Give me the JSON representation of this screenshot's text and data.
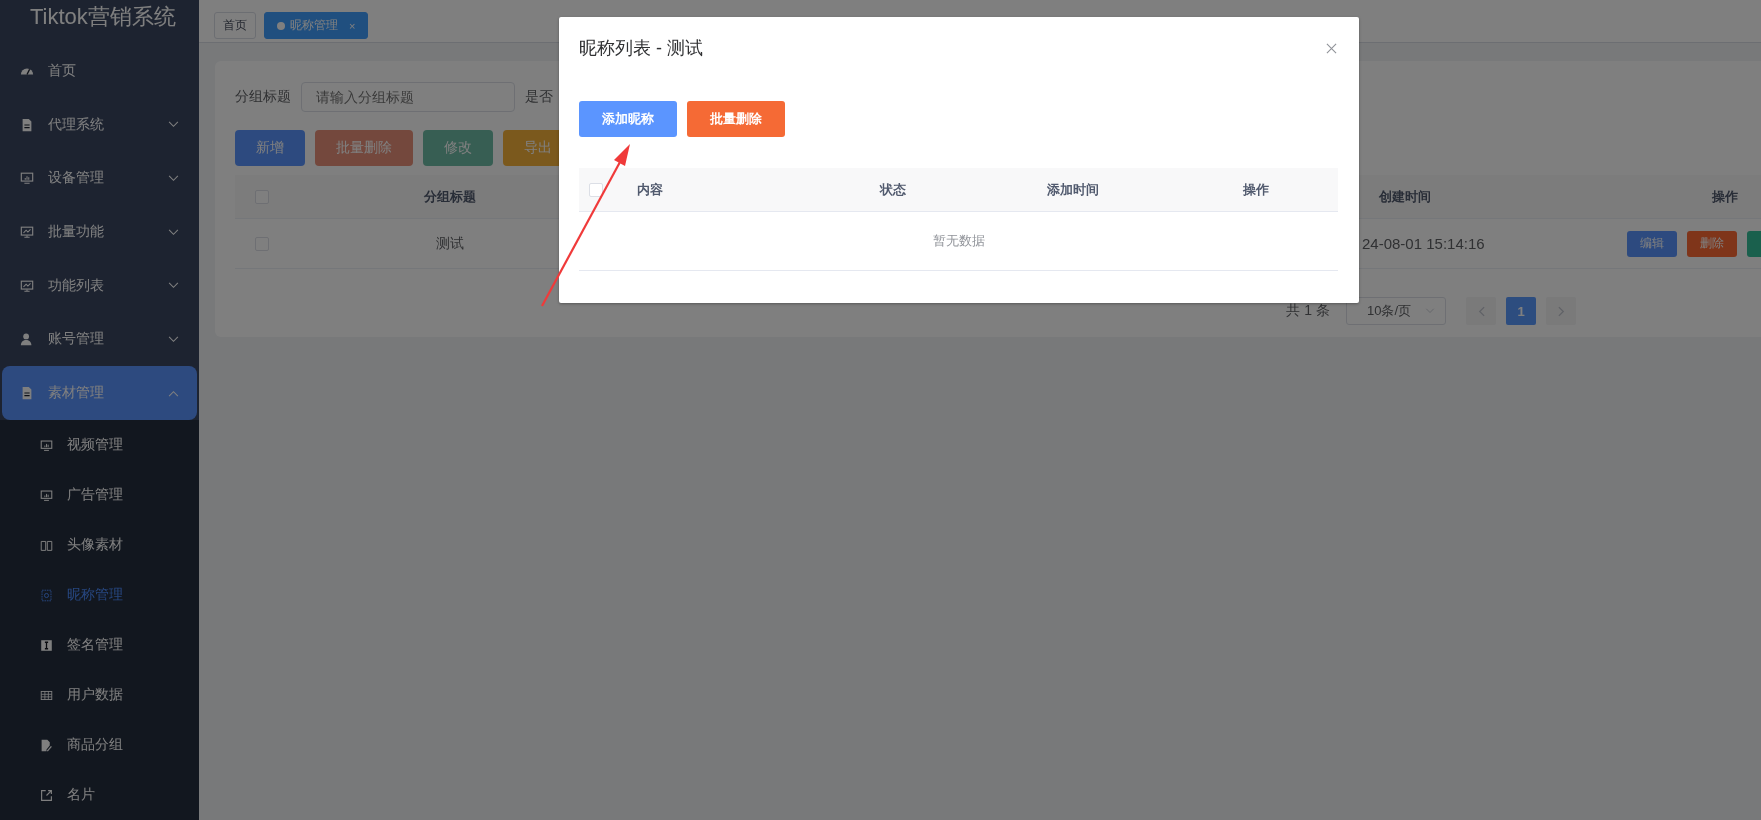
{
  "sidebar": {
    "logo": "Tiktok营销系统",
    "items": [
      {
        "label": "首页",
        "selected": false
      },
      {
        "label": "代理系统",
        "selected": false,
        "expanded": false
      },
      {
        "label": "设备管理",
        "selected": false,
        "expanded": false
      },
      {
        "label": "批量功能",
        "selected": false,
        "expanded": false
      },
      {
        "label": "功能列表",
        "selected": false,
        "expanded": false
      },
      {
        "label": "账号管理",
        "selected": false,
        "expanded": false
      },
      {
        "label": "素材管理",
        "selected": true,
        "expanded": true,
        "children": [
          {
            "label": "视频管理",
            "selected": false
          },
          {
            "label": "广告管理",
            "selected": false
          },
          {
            "label": "头像素材",
            "selected": false
          },
          {
            "label": "昵称管理",
            "selected": true
          },
          {
            "label": "签名管理",
            "selected": false
          },
          {
            "label": "用户数据",
            "selected": false
          },
          {
            "label": "商品分组",
            "selected": false
          },
          {
            "label": "名片",
            "selected": false
          }
        ]
      }
    ]
  },
  "tabs": [
    {
      "label": "首页",
      "selected": false
    },
    {
      "label": "昵称管理",
      "selected": true,
      "close": "×"
    }
  ],
  "filter": {
    "label": "分组标题",
    "placeholder": "请输入分组标题",
    "label_2": "是否"
  },
  "toolbar": [
    {
      "label": "新增",
      "kind": "primary",
      "disabled": false
    },
    {
      "label": "批量删除",
      "kind": "danger",
      "disabled": true
    },
    {
      "label": "修改",
      "kind": "success",
      "disabled": true
    },
    {
      "label": "导出",
      "kind": "warning",
      "disabled": false
    }
  ],
  "table": {
    "select_all_checked": false,
    "columns": [
      "分组标题",
      "创建时间",
      "操作"
    ],
    "rows": [
      {
        "checked": false,
        "title": "测试",
        "created": "24-08-01 15:14:16",
        "actions": [
          {
            "label": "编辑",
            "kind": "primary"
          },
          {
            "label": "删除",
            "kind": "danger"
          },
          {
            "kind": "success"
          }
        ]
      }
    ]
  },
  "pagination": {
    "total": "共 1 条",
    "page_size": "10条/页",
    "pages": [
      {
        "label": "1",
        "selected": true
      }
    ]
  },
  "modal": {
    "title": "昵称列表 - 测试",
    "buttons": [
      {
        "label": "添加昵称",
        "kind": "primary"
      },
      {
        "label": "批量删除",
        "kind": "orange"
      }
    ],
    "table": {
      "select_all_checked": false,
      "columns": [
        "内容",
        "状态",
        "添加时间",
        "操作"
      ],
      "empty_text": "暂无数据"
    }
  }
}
